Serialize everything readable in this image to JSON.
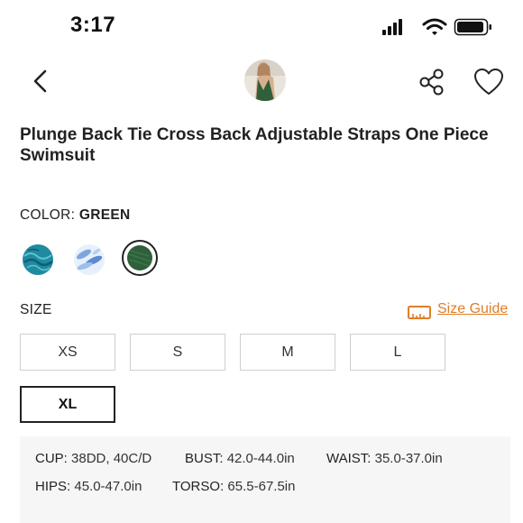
{
  "status_bar": {
    "time": "3:17"
  },
  "nav": {
    "back_icon": "chevron-left-icon",
    "avatar": "product-thumbnail",
    "share_icon": "share-icon",
    "favorite_icon": "heart-icon"
  },
  "product": {
    "title": "Plunge Back Tie Cross Back Adjustable Straps One Piece Swimsuit"
  },
  "color": {
    "label": "COLOR:",
    "selected": "GREEN",
    "swatches": [
      {
        "name": "teal-pattern",
        "color": "#1f8aa0"
      },
      {
        "name": "blue-leaf-pattern",
        "color": "#9bbbe6"
      },
      {
        "name": "green",
        "color": "#2f5f3b",
        "selected": true
      }
    ]
  },
  "size": {
    "label": "SIZE",
    "guide_label": "Size Guide",
    "options": [
      "XS",
      "S",
      "M",
      "L",
      "XL"
    ],
    "selected": "XL"
  },
  "measurements": {
    "cup": {
      "key": "CUP:",
      "value": "38DD, 40C/D"
    },
    "bust": {
      "key": "BUST:",
      "value": "42.0-44.0in"
    },
    "waist": {
      "key": "WAIST:",
      "value": "35.0-37.0in"
    },
    "hips": {
      "key": "HIPS:",
      "value": "45.0-47.0in"
    },
    "torso": {
      "key": "TORSO:",
      "value": "65.5-67.5in"
    }
  },
  "colors": {
    "accent": "#e07e2a",
    "selected_border": "#222222"
  }
}
